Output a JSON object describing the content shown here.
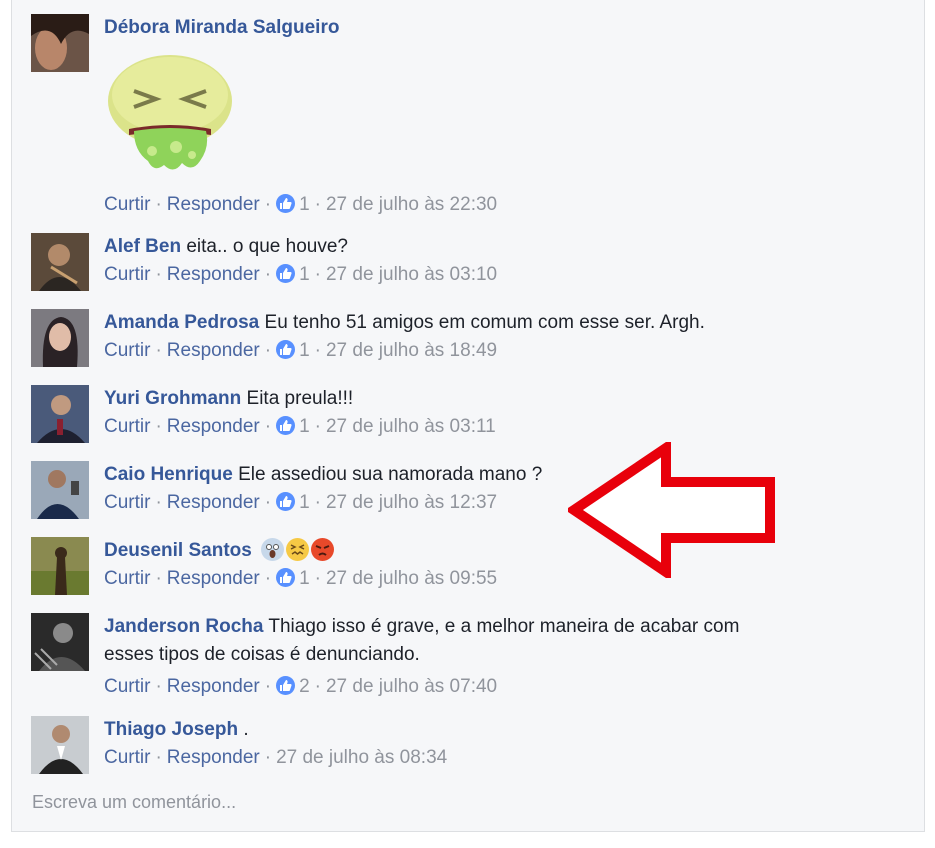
{
  "comments": [
    {
      "name": "Débora Miranda Salgueiro",
      "text": "",
      "actions": {
        "like": "Curtir",
        "reply": "Responder",
        "likes": "1",
        "time": "27 de julho às 22:30"
      }
    },
    {
      "name": "Alef Ben",
      "text": "eita.. o que houve?",
      "actions": {
        "like": "Curtir",
        "reply": "Responder",
        "likes": "1",
        "time": "27 de julho às 03:10"
      }
    },
    {
      "name": "Amanda Pedrosa",
      "text": "Eu tenho 51 amigos em comum com esse ser. Argh.",
      "actions": {
        "like": "Curtir",
        "reply": "Responder",
        "likes": "1",
        "time": "27 de julho às 18:49"
      }
    },
    {
      "name": "Yuri Grohmann",
      "text": "Eita preula!!!",
      "actions": {
        "like": "Curtir",
        "reply": "Responder",
        "likes": "1",
        "time": "27 de julho às 03:11"
      }
    },
    {
      "name": "Caio Henrique",
      "text": "Ele assediou sua namorada mano ?",
      "actions": {
        "like": "Curtir",
        "reply": "Responder",
        "likes": "1",
        "time": "27 de julho às 12:37"
      }
    },
    {
      "name": "Deusenil Santos",
      "text": "",
      "emojis": [
        "scream-emoji",
        "confounded-emoji",
        "angry-emoji"
      ],
      "actions": {
        "like": "Curtir",
        "reply": "Responder",
        "likes": "1",
        "time": "27 de julho às 09:55"
      }
    },
    {
      "name": "Janderson Rocha",
      "text": "Thiago isso é grave, e a melhor maneira de acabar com",
      "text2": "esses tipos de coisas é denunciando.",
      "actions": {
        "like": "Curtir",
        "reply": "Responder",
        "likes": "2",
        "time": "27 de julho às 07:40"
      }
    },
    {
      "name": "Thiago Joseph",
      "text": ".",
      "actions": {
        "like": "Curtir",
        "reply": "Responder",
        "time": "27 de julho às 08:34"
      }
    }
  ],
  "write_comment_placeholder": "Escreva um comentário...",
  "colors": {
    "name": "#365899",
    "link": "#4b67a1",
    "meta": "#90949c",
    "like": "#5890ff",
    "arrow": "#e8000b",
    "panel": "#f6f7f9"
  },
  "icons": {
    "like": "thumbs-up-icon",
    "arrow": "red-arrow-annotation",
    "sticker": "vomiting-face-sticker"
  }
}
